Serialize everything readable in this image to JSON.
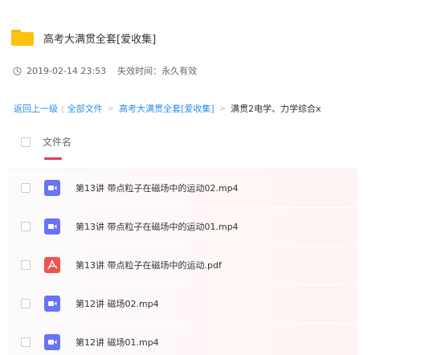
{
  "folder": {
    "title": "高考大满贯全套[爱收集]",
    "date": "2019-02-14 23:53",
    "expiry": "失效时间：永久有效"
  },
  "breadcrumb": {
    "back": "返回上一级",
    "sep": "|",
    "all_files": "全部文件",
    "arrow": ">",
    "parent": "高考大满贯全套[爱收集]",
    "current": "满贯2电学、力学综合x"
  },
  "table": {
    "column_name": "文件名",
    "rows": [
      {
        "name": "第13讲 带点粒子在磁场中的运动02.mp4",
        "icon": "video-icon"
      },
      {
        "name": "第13讲 带点粒子在磁场中的运动01.mp4",
        "icon": "video-icon"
      },
      {
        "name": "第13讲 带点粒子在磁场中的运动.pdf",
        "icon": "pdf-icon"
      },
      {
        "name": "第12讲 磁场02.mp4",
        "icon": "video-icon"
      },
      {
        "name": "第12讲 磁场01.mp4",
        "icon": "video-icon"
      }
    ]
  },
  "colors": {
    "folder": "#ffc20e",
    "link": "#2b8fe8",
    "video_icon": "#6a72f5",
    "pdf_icon": "#f2524f",
    "sort_indicator": "#e8384f"
  }
}
